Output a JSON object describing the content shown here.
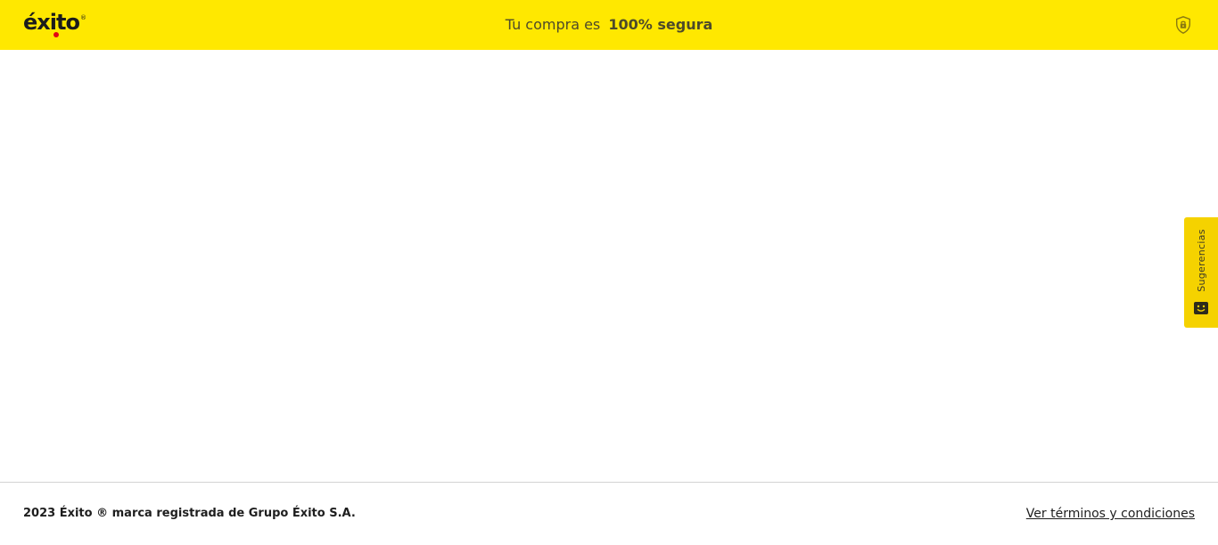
{
  "header": {
    "logo_text": "éxito",
    "logo_reg_mark": "®",
    "secure_prefix": "Tu compra es",
    "secure_bold": "100% segura",
    "shield_icon": "shield-lock-icon"
  },
  "side_tab": {
    "label": "Sugerencias",
    "icon": "smile-face-icon"
  },
  "footer": {
    "copyright": "2023 Éxito ® marca registrada de Grupo Éxito S.A.",
    "terms_link": "Ver términos y condiciones"
  },
  "colors": {
    "brand_yellow": "#ffe800",
    "tab_yellow": "#f5d200",
    "logo_red": "#e30613",
    "text_dark": "#1e1e1e"
  }
}
